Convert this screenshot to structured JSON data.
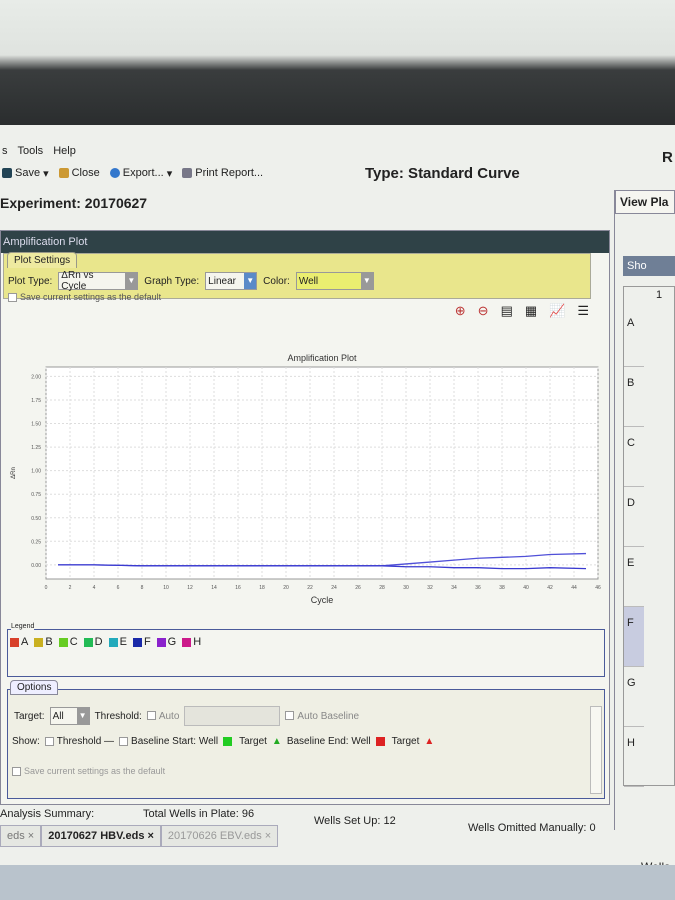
{
  "menu": {
    "items": [
      "s",
      "Tools",
      "Help"
    ]
  },
  "toolbar": {
    "save": "Save",
    "close": "Close",
    "export": "Export...",
    "print": "Print Report..."
  },
  "header": {
    "type_title": "Type: Standard Curve",
    "experiment": "Experiment: 20170627",
    "r_label": "R"
  },
  "panel": {
    "title": "Amplification Plot"
  },
  "plot_settings": {
    "tab": "Plot Settings",
    "plot_type_label": "Plot Type:",
    "plot_type": "ΔRn vs Cycle",
    "graph_type_label": "Graph Type:",
    "graph_type": "Linear",
    "color_label": "Color:",
    "color": "Well",
    "save_default": "Save current settings as the default"
  },
  "chart_data": {
    "type": "line",
    "title": "Amplification Plot",
    "xlabel": "Cycle",
    "ylabel": "ΔRn",
    "xlim": [
      0,
      46
    ],
    "ylim": [
      -0.15,
      2.1
    ],
    "grid": true,
    "x_ticks": [
      0,
      2,
      4,
      6,
      8,
      10,
      12,
      14,
      16,
      18,
      20,
      22,
      24,
      26,
      28,
      30,
      32,
      34,
      36,
      38,
      40,
      42,
      44,
      46
    ],
    "y_ticks": [
      "0.00",
      "0.25",
      "0.50",
      "0.75",
      "1.00",
      "1.25",
      "1.50",
      "1.75",
      "2.00"
    ],
    "series": [
      {
        "color": "#5050d8",
        "x": [
          1,
          4,
          8,
          12,
          16,
          20,
          24,
          28,
          30,
          32,
          34,
          36,
          38,
          40,
          42,
          45
        ],
        "y": [
          0,
          0,
          -0.01,
          -0.01,
          -0.01,
          -0.01,
          -0.01,
          -0.01,
          0.01,
          0.03,
          0.05,
          0.07,
          0.08,
          0.09,
          0.11,
          0.12
        ]
      },
      {
        "color": "#3a3ad0",
        "x": [
          1,
          4,
          8,
          12,
          16,
          20,
          24,
          28,
          30,
          32,
          34,
          36,
          38,
          40,
          42,
          45
        ],
        "y": [
          0,
          0,
          -0.01,
          -0.01,
          -0.01,
          -0.01,
          -0.01,
          -0.01,
          -0.02,
          -0.02,
          -0.03,
          -0.03,
          -0.04,
          -0.04,
          -0.03,
          -0.04
        ]
      }
    ]
  },
  "legend": {
    "title": "Legend",
    "items": [
      {
        "label": "A",
        "color": "#d8402a"
      },
      {
        "label": "B",
        "color": "#c9b020"
      },
      {
        "label": "C",
        "color": "#66cc22"
      },
      {
        "label": "D",
        "color": "#22bb55"
      },
      {
        "label": "E",
        "color": "#22aabb"
      },
      {
        "label": "F",
        "color": "#1a2aa8"
      },
      {
        "label": "G",
        "color": "#8a22cc"
      },
      {
        "label": "H",
        "color": "#cc1a8a"
      }
    ]
  },
  "options": {
    "tab": "Options",
    "target_label": "Target:",
    "target": "All",
    "threshold_label": "Threshold:",
    "auto": "Auto",
    "auto_baseline": "Auto Baseline",
    "show_label": "Show:",
    "threshold": "Threshold",
    "baseline_start": "Baseline Start: Well",
    "target1": "Target",
    "baseline_end": "Baseline End: Well",
    "target2": "Target",
    "save_default": "Save current settings as the default"
  },
  "summary": {
    "label": "Analysis Summary:",
    "total": "Total Wells in Plate: 96",
    "setup": "Wells Set Up: 12",
    "omitted": "Wells Omitted Manually: 0"
  },
  "file_tabs": [
    "eds ×",
    "20170627  HBV.eds ×",
    "20170626  EBV.eds ×"
  ],
  "right_panel": {
    "title": "View Pla",
    "show": "Sho",
    "col": "1",
    "rows": [
      "A",
      "B",
      "C",
      "D",
      "E",
      "F",
      "G",
      "H"
    ],
    "wells": "Wells"
  }
}
